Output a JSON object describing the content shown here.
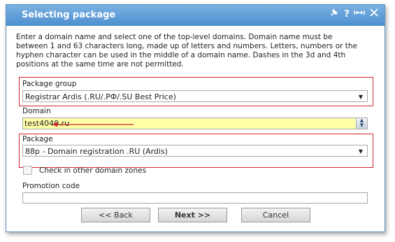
{
  "dialog": {
    "title": "Selecting package",
    "icons": [
      "pin-icon",
      "help-icon",
      "resize-icon",
      "close-icon"
    ],
    "description": "Enter a domain name and select one of the top-level domains. Domain name must be between 1 and 63 characters long, made up of letters and numbers. Letters, numbers or the hyphen character can be used in the middle of a domain name. Dashes in the 3d and 4th positions at the same time are not permitted."
  },
  "form": {
    "package_group_label": "Package group",
    "package_group_value": "Registrar Ardis (.RU/.РФ/.SU Best Price)",
    "domain_label": "Domain",
    "domain_value": "test4040.ru",
    "package_label": "Package",
    "package_value": "88p - Domain registration .RU (Ardis)",
    "check_other_label": "Check in other domain zones",
    "check_other_checked": false,
    "promo_label": "Promotion code",
    "promo_value": ""
  },
  "buttons": {
    "back": "<< Back",
    "next": "Next >>",
    "cancel": "Cancel"
  },
  "colors": {
    "titlebar": "#5d9bd6",
    "annotation_red": "#d2232a",
    "domain_field_bg": "#ffffa8"
  }
}
